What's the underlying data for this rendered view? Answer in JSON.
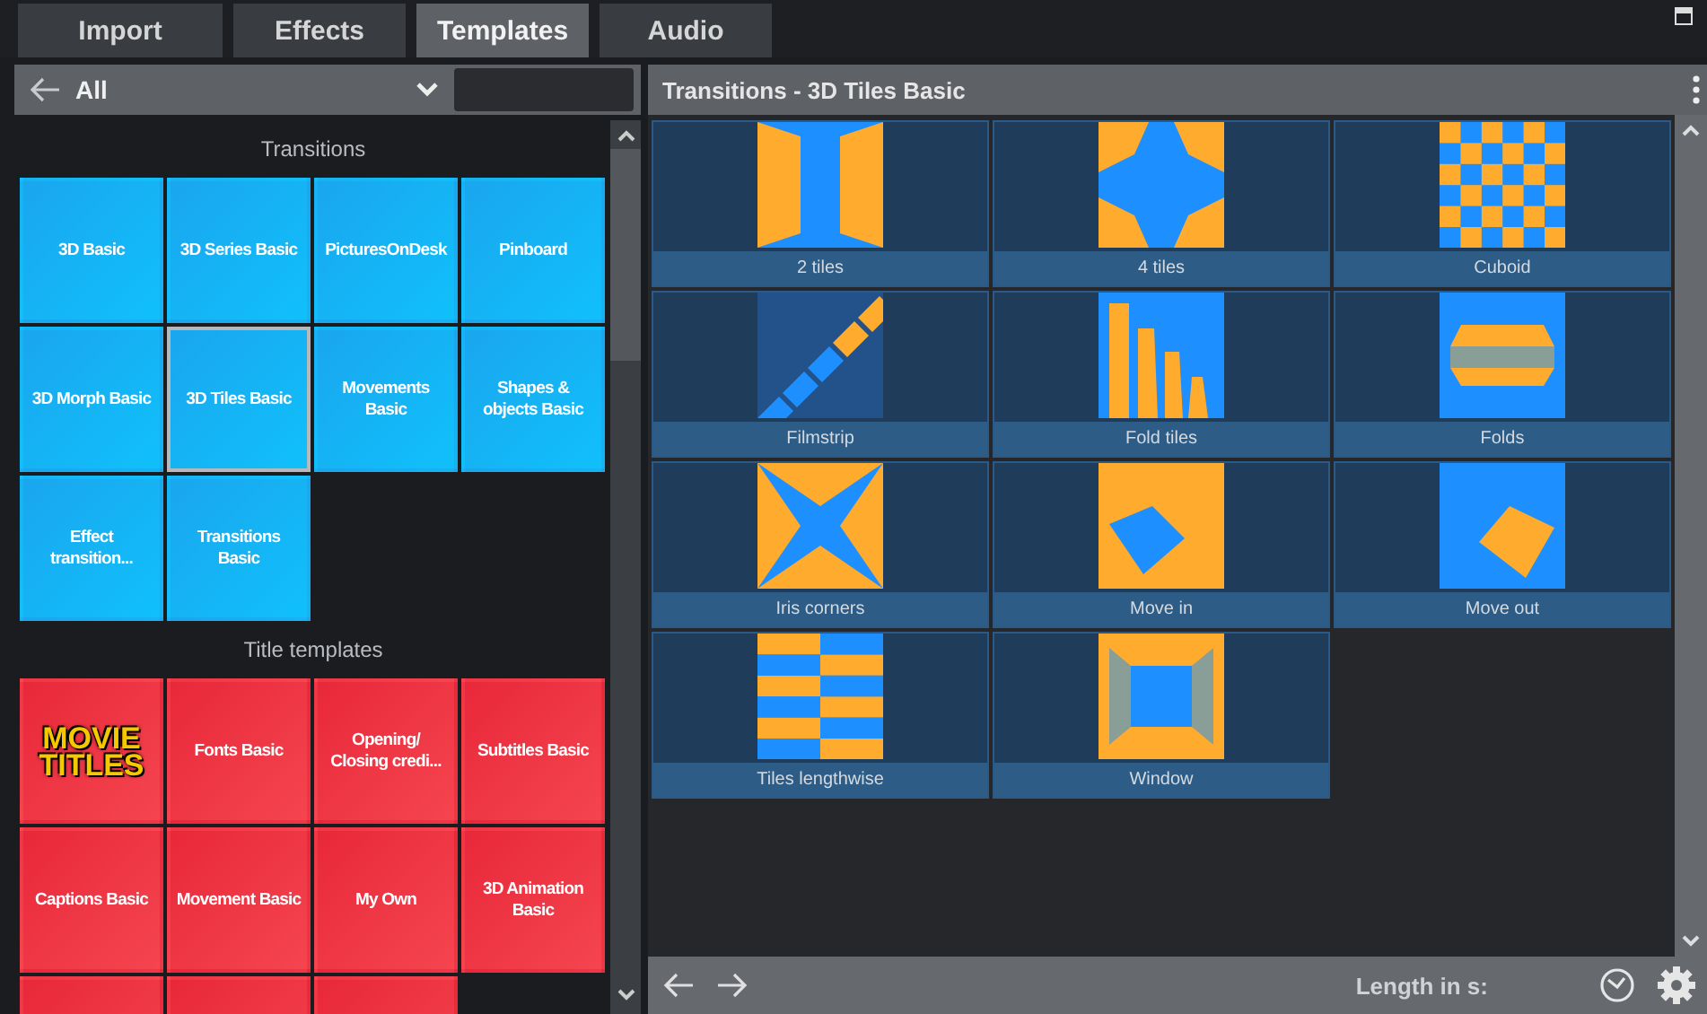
{
  "tabs": [
    {
      "label": "Import",
      "selected": false
    },
    {
      "label": "Effects",
      "selected": false
    },
    {
      "label": "Templates",
      "selected": true
    },
    {
      "label": "Audio",
      "selected": false
    }
  ],
  "browser": {
    "filter": "All",
    "sections": [
      {
        "title": "Transitions",
        "kind": "transition",
        "tiles": [
          {
            "label": "3D Basic",
            "selected": false
          },
          {
            "label": "3D Series Basic",
            "selected": false
          },
          {
            "label": "PicturesOnDesk",
            "selected": false
          },
          {
            "label": "Pinboard",
            "selected": false
          },
          {
            "label": "3D Morph Basic",
            "selected": false
          },
          {
            "label": "3D Tiles Basic",
            "selected": true
          },
          {
            "label": "Movements Basic",
            "selected": false
          },
          {
            "label": "Shapes & objects Basic",
            "selected": false
          },
          {
            "label": "Effect transition...",
            "selected": false
          },
          {
            "label": "Transitions Basic",
            "selected": false
          }
        ]
      },
      {
        "title": "Title templates",
        "kind": "title",
        "tiles": [
          {
            "label": "MOVIE TITLES",
            "kind": "logo",
            "selected": false
          },
          {
            "label": "Fonts Basic",
            "kind": "text",
            "selected": false
          },
          {
            "label": "Opening/ Closing credi...",
            "kind": "text",
            "selected": false
          },
          {
            "label": "Subtitles Basic",
            "kind": "text",
            "selected": false
          },
          {
            "label": "Captions Basic",
            "kind": "text",
            "selected": false
          },
          {
            "label": "Movement Basic",
            "kind": "text",
            "selected": false
          },
          {
            "label": "My Own",
            "kind": "text",
            "selected": false
          },
          {
            "label": "3D Animation Basic",
            "kind": "text",
            "selected": false
          },
          {
            "kind": "text",
            "selected": false
          },
          {
            "kind": "text",
            "selected": false
          },
          {
            "kind": "text",
            "selected": false
          }
        ]
      }
    ]
  },
  "preview": {
    "title": "Transitions - 3D Tiles Basic",
    "cards": [
      {
        "label": "2 tiles"
      },
      {
        "label": "4 tiles"
      },
      {
        "label": "Cuboid"
      },
      {
        "label": "Filmstrip"
      },
      {
        "label": "Fold tiles"
      },
      {
        "label": "Folds"
      },
      {
        "label": "Iris corners"
      },
      {
        "label": "Move in"
      },
      {
        "label": "Move out"
      },
      {
        "label": "Tiles lengthwise"
      },
      {
        "label": "Window"
      }
    ],
    "footer": {
      "length_label": "Length in s:"
    }
  }
}
